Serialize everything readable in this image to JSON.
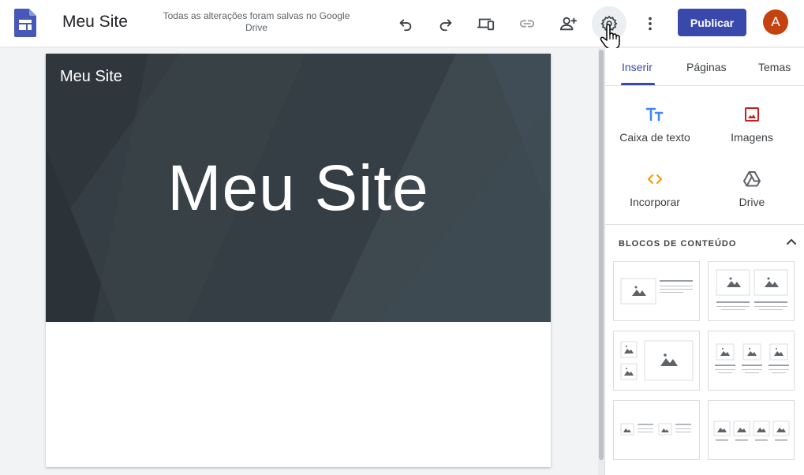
{
  "header": {
    "site_title": "Meu Site",
    "save_status": "Todas as alterações foram salvas no Google Drive",
    "publish_label": "Publicar",
    "avatar_letter": "A",
    "icons": [
      "undo-icon",
      "redo-icon",
      "preview-devices-icon",
      "link-icon",
      "share-person-add-icon",
      "settings-gear-icon",
      "more-vert-icon"
    ]
  },
  "page": {
    "nav_title": "Meu Site",
    "hero_title": "Meu Site"
  },
  "panel": {
    "tabs": [
      {
        "label": "Inserir",
        "active": true
      },
      {
        "label": "Páginas",
        "active": false
      },
      {
        "label": "Temas",
        "active": false
      }
    ],
    "insert_items": [
      {
        "label": "Caixa de texto",
        "icon": "text-box-icon",
        "color": "#4285f4"
      },
      {
        "label": "Imagens",
        "icon": "image-icon",
        "color": "#c5221f"
      },
      {
        "label": "Incorporar",
        "icon": "embed-icon",
        "color": "#f29900"
      },
      {
        "label": "Drive",
        "icon": "drive-icon",
        "color": "#5f6368"
      }
    ],
    "content_blocks_title": "BLOCOS DE CONTEÚDO"
  },
  "colors": {
    "accent": "#3949ab",
    "avatar": "#c3420f",
    "hero_bg": "#343d43"
  }
}
